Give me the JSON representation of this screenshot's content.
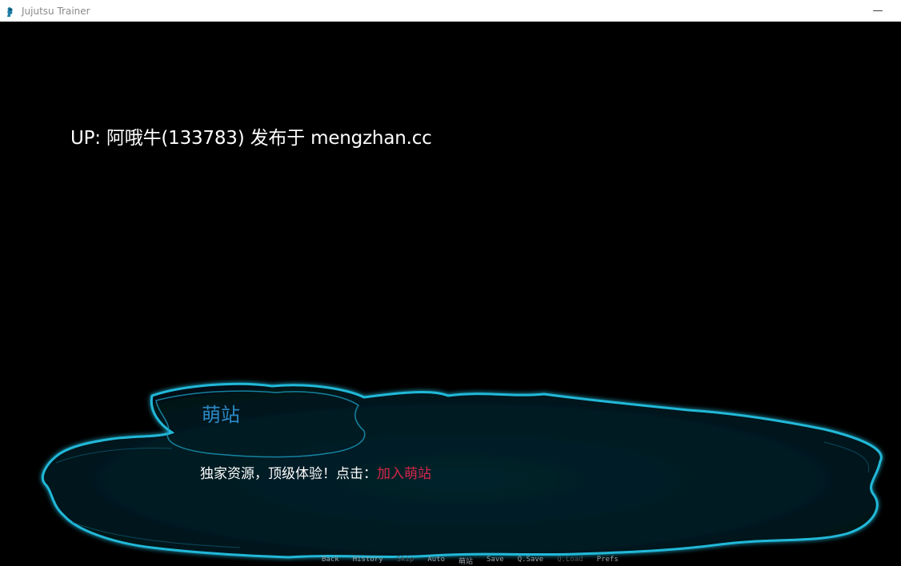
{
  "window": {
    "title": "Jujutsu Trainer",
    "minimize_glyph": "—"
  },
  "game": {
    "watermark": "UP: 阿哦牛(133783) 发布于 mengzhan.cc",
    "speaker": "萌站",
    "dialogue_text": "独家资源，顶级体验！点击：",
    "dialogue_link": "加入萌站",
    "colors": {
      "speaker": "#2a88c4",
      "link": "#d6254a",
      "splash_glow": "#22b8d8",
      "splash_fill": "#02161c"
    }
  },
  "quick_menu": [
    {
      "label": "Back",
      "enabled": true
    },
    {
      "label": "History",
      "enabled": true
    },
    {
      "label": "Skip",
      "enabled": false
    },
    {
      "label": "Auto",
      "enabled": true
    },
    {
      "label": "萌站",
      "enabled": true
    },
    {
      "label": "Save",
      "enabled": true
    },
    {
      "label": "Q.Save",
      "enabled": true
    },
    {
      "label": "Q.Load",
      "enabled": false
    },
    {
      "label": "Prefs",
      "enabled": true
    }
  ]
}
